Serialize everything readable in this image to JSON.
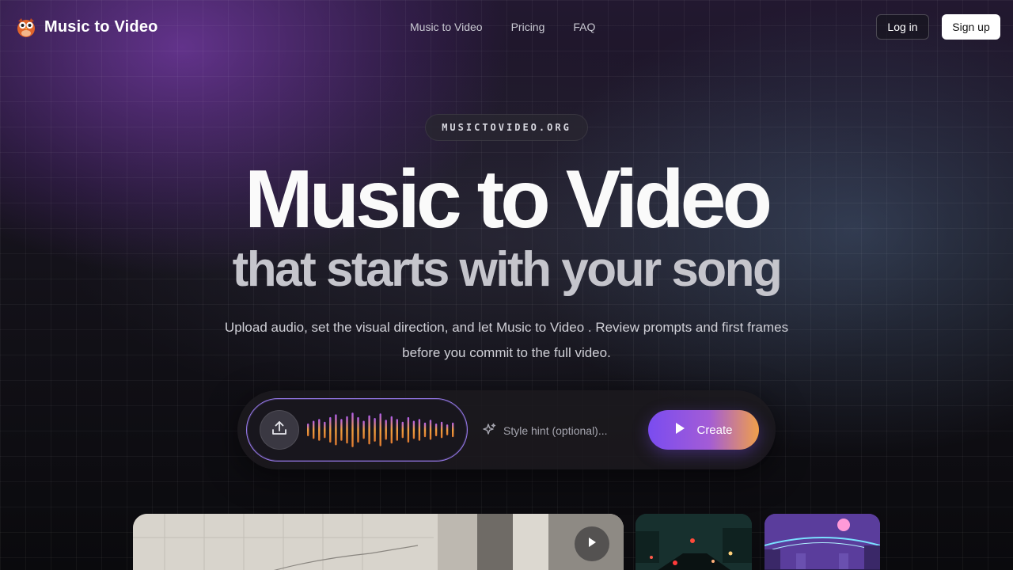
{
  "brand": {
    "name": "Music to Video",
    "logo_icon": "owl-icon"
  },
  "nav": {
    "links": [
      "Music to Video",
      "Pricing",
      "FAQ"
    ],
    "login_label": "Log in",
    "signup_label": "Sign up"
  },
  "hero": {
    "badge": "MUSICTOVIDEO.ORG",
    "title": "Music to Video",
    "subtitle": "that starts with your song",
    "description_line1": "Upload audio, set the visual direction, and let Music to Video . Review prompts and first frames",
    "description_line2": "before you commit to the full video."
  },
  "composer": {
    "upload_icon": "upload-icon",
    "waveform_levels": [
      0.35,
      0.5,
      0.6,
      0.45,
      0.7,
      0.85,
      0.6,
      0.75,
      0.95,
      0.7,
      0.5,
      0.8,
      0.65,
      0.9,
      0.55,
      0.75,
      0.6,
      0.45,
      0.7,
      0.5,
      0.6,
      0.4,
      0.55,
      0.35,
      0.45,
      0.3,
      0.4
    ],
    "style_hint_placeholder": "Style hint (optional)...",
    "create_label": "Create",
    "colors": {
      "accent_start": "#7a4cf0",
      "accent_end": "#f0a04a",
      "border": "#9a7cf0"
    }
  }
}
